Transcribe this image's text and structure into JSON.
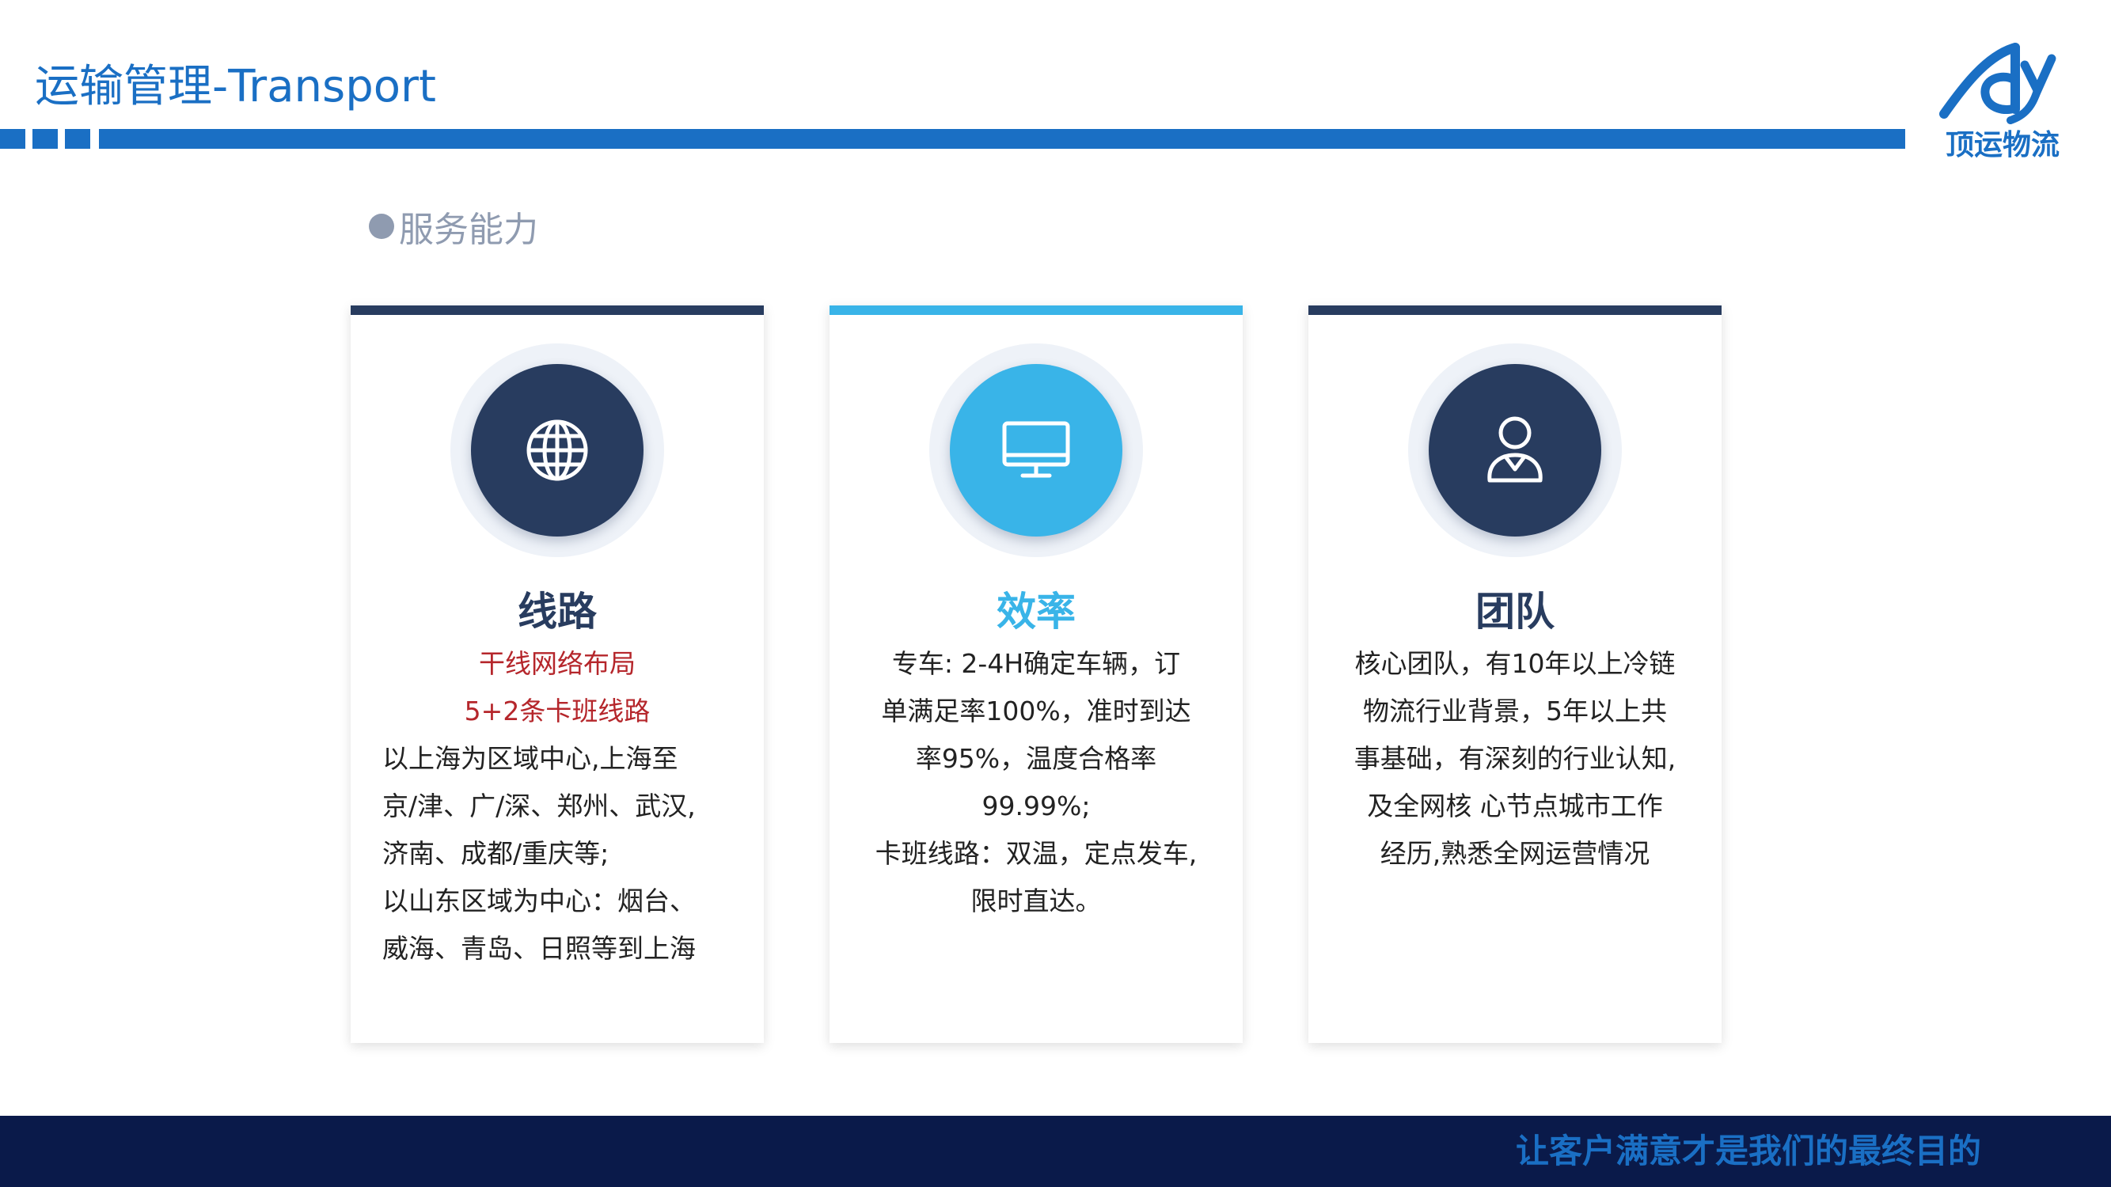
{
  "header": {
    "title": "运输管理-Transport"
  },
  "logo": {
    "text": "顶运物流"
  },
  "section": {
    "heading": "服务能力"
  },
  "cards": [
    {
      "title": "线路",
      "icon": "globe-icon",
      "accent_color": "#283c5f",
      "lines": [
        "干线网络布局",
        "5+2条卡班线路",
        "以上海为区域中心,上海至",
        "京/津、广/深、郑州、武汉,",
        "济南、成都/重庆等;",
        "以山东区域为中心：烟台、",
        "威海、青岛、日照等到上海"
      ]
    },
    {
      "title": "效率",
      "icon": "monitor-icon",
      "accent_color": "#39b4e8",
      "lines": [
        "专车: 2-4H确定车辆，订",
        "单满足率100%，准时到达",
        "率95%，温度合格率",
        "99.99%;",
        "卡班线路：双温，定点发车,",
        "限时直达。"
      ]
    },
    {
      "title": "团队",
      "icon": "user-icon",
      "accent_color": "#283c5f",
      "lines": [
        "核心团队，有10年以上冷链",
        "物流行业背景，5年以上共",
        "事基础，有深刻的行业认知,",
        "及全网核 心节点城市工作",
        "经历,熟悉全网运营情况"
      ]
    }
  ],
  "colors": {
    "brand_blue": "#1a6fc4",
    "navy": "#283c5f",
    "light_blue": "#39b4e8",
    "highlight_red": "#b5262b",
    "footer_bg": "#0a1a4a"
  },
  "footer": {
    "slogan": "让客户满意才是我们的最终目的"
  }
}
